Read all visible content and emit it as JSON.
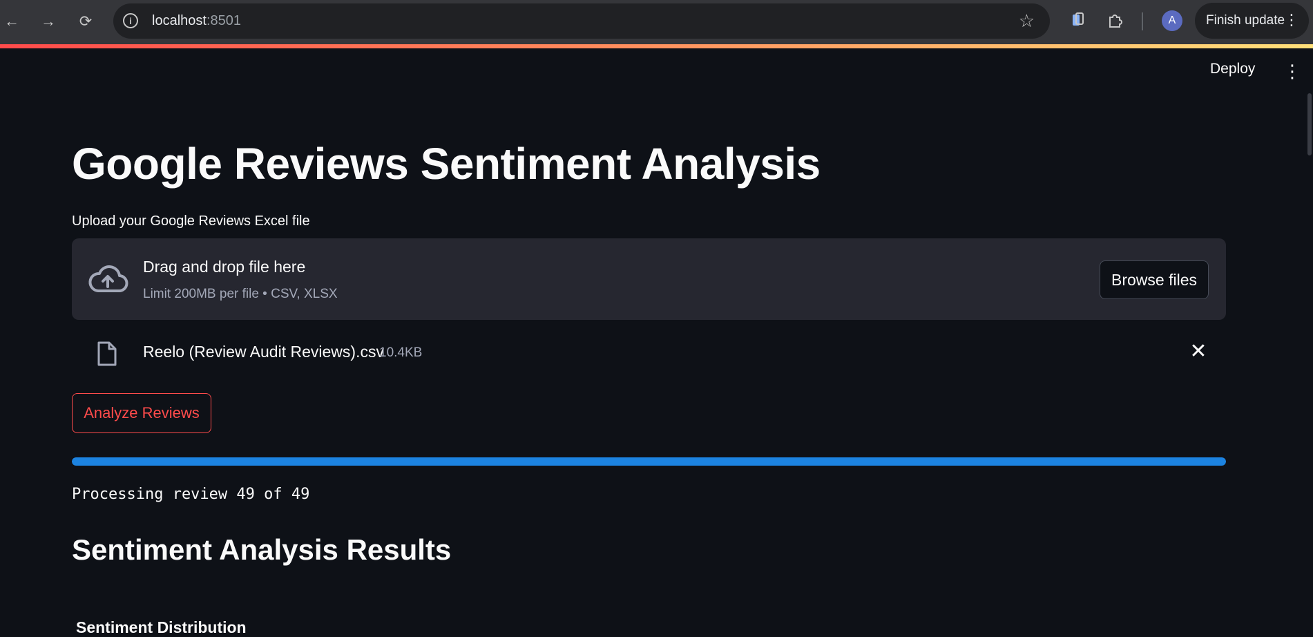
{
  "browser": {
    "url_host": "localhost",
    "url_port": ":8501",
    "profile_initial": "A",
    "finish_update_label": "Finish update"
  },
  "header": {
    "deploy_label": "Deploy"
  },
  "app": {
    "title": "Google Reviews Sentiment Analysis",
    "uploader": {
      "label": "Upload your Google Reviews Excel file",
      "drop_text": "Drag and drop file here",
      "limit_text": "Limit 200MB per file • CSV, XLSX",
      "browse_label": "Browse files"
    },
    "uploaded_file": {
      "name": "Reelo (Review Audit Reviews).csv",
      "size": "10.4KB"
    },
    "analyze_label": "Analyze Reviews",
    "progress": {
      "fraction": 1.0
    },
    "processing_text": "Processing review 49 of 49",
    "results_heading": "Sentiment Analysis Results",
    "distribution_heading": "Sentiment Distribution"
  },
  "colors": {
    "background": "#0e1117",
    "primary": "#ff4b4b",
    "progress": "#1c83e1",
    "secondary_bg": "#262730"
  }
}
